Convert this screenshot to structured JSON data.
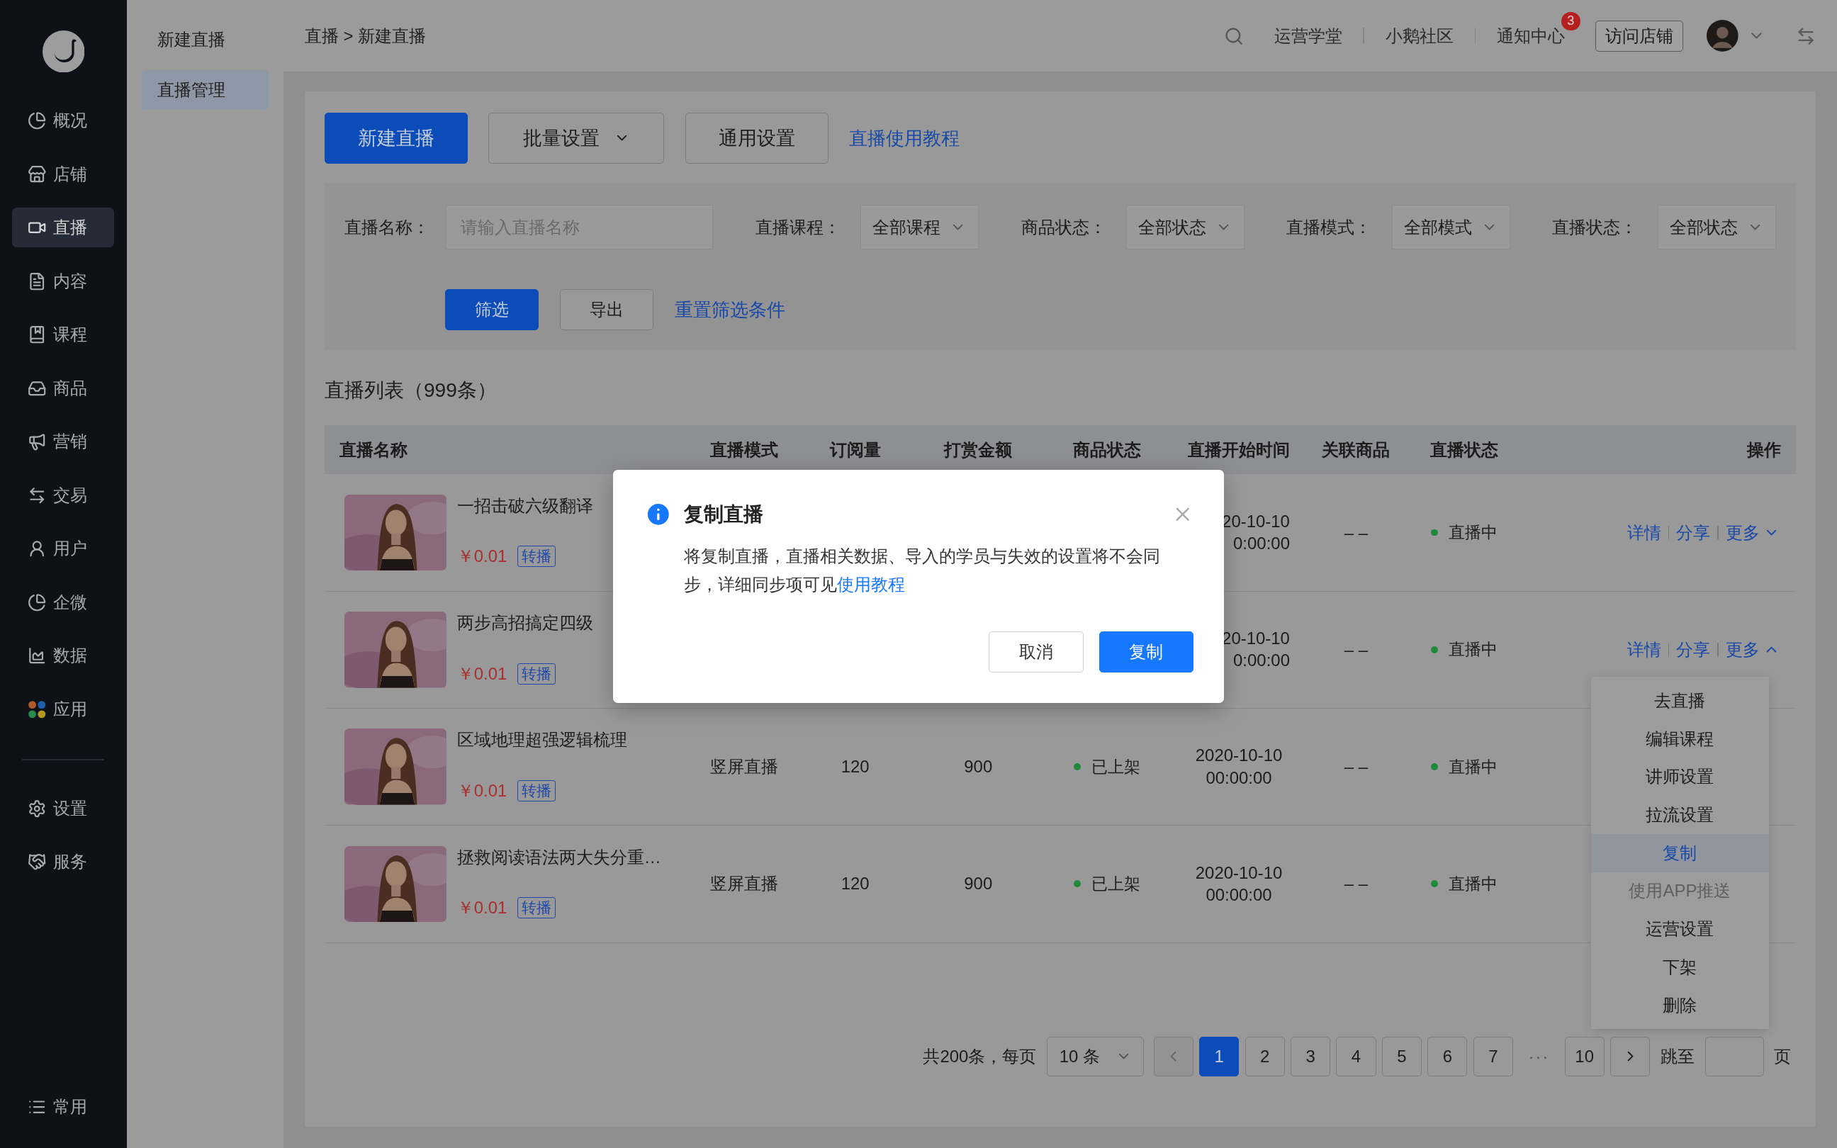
{
  "sidebar": {
    "items": [
      {
        "label": "概况",
        "selected": false
      },
      {
        "label": "店铺",
        "selected": false
      },
      {
        "label": "直播",
        "selected": true
      },
      {
        "label": "内容",
        "selected": false
      },
      {
        "label": "课程",
        "selected": false
      },
      {
        "label": "商品",
        "selected": false
      },
      {
        "label": "营销",
        "selected": false
      },
      {
        "label": "交易",
        "selected": false
      },
      {
        "label": "用户",
        "selected": false
      },
      {
        "label": "企微",
        "selected": false
      },
      {
        "label": "数据",
        "selected": false
      },
      {
        "label": "应用",
        "selected": false
      }
    ],
    "bottom_items": [
      {
        "label": "设置",
        "selected": false
      },
      {
        "label": "服务",
        "selected": false
      }
    ],
    "footer_item": {
      "label": "常用"
    }
  },
  "sub_sidebar": {
    "items": [
      {
        "label": "新建直播",
        "selected": false
      },
      {
        "label": "直播管理",
        "selected": true
      }
    ]
  },
  "breadcrumb": "直播 > 新建直播",
  "header": {
    "links": [
      "运营学堂",
      "小鹅社区",
      "通知中心"
    ],
    "notification_badge": "3",
    "store_button": "访问店铺"
  },
  "toolbar": {
    "buttons": [
      {
        "label": "新建直播",
        "kind": "primary"
      },
      {
        "label": "批量设置",
        "kind": "dropdown"
      },
      {
        "label": "通用设置",
        "kind": "default"
      }
    ],
    "tutorial_link": "直播使用教程"
  },
  "filters": {
    "name_field": {
      "label": "直播名称：",
      "placeholder": "请输入直播名称"
    },
    "selects": [
      {
        "label": "直播课程：",
        "value": "全部课程"
      },
      {
        "label": "商品状态：",
        "value": "全部状态"
      },
      {
        "label": "直播模式：",
        "value": "全部模式"
      },
      {
        "label": "直播状态：",
        "value": "全部状态"
      }
    ],
    "buttons": [
      {
        "label": "筛选",
        "kind": "primary"
      },
      {
        "label": "导出",
        "kind": "default"
      }
    ],
    "reset_link": "重置筛选条件"
  },
  "list_title": "直播列表（999条）",
  "table": {
    "columns": [
      "直播名称",
      "直播模式",
      "订阅量",
      "打赏金额",
      "商品状态",
      "直播开始时间",
      "关联商品",
      "直播状态",
      "操作"
    ],
    "rows": [
      {
        "kind": "covered",
        "name": "一招击破六级翻译",
        "price": "￥0.01",
        "tag": "转播",
        "start_time": [
          "20-10-10",
          "0:00:00"
        ],
        "related": "– –",
        "live_status": "直播中",
        "actions": [
          "详情",
          "分享"
        ],
        "more": {
          "label": "更多",
          "expanded": false
        }
      },
      {
        "kind": "covered",
        "name": "两步高招搞定四级",
        "price": "￥0.01",
        "tag": "转播",
        "start_time": [
          "20-10-10",
          "0:00:00"
        ],
        "related": "– –",
        "live_status": "直播中",
        "actions": [
          "详情",
          "分享"
        ],
        "more": {
          "label": "更多",
          "expanded": true
        }
      },
      {
        "kind": "full",
        "name": "区域地理超强逻辑梳理",
        "price": "￥0.01",
        "tag": "转播",
        "mode": "竖屏直播",
        "subscriptions": "120",
        "amount": "900",
        "product_status": "已上架",
        "start_time": [
          "2020-10-10",
          "00:00:00"
        ],
        "related": "– –",
        "live_status": "直播中"
      },
      {
        "kind": "full",
        "name": "拯救阅读语法两大失分重…",
        "price": "￥0.01",
        "tag": "转播",
        "mode": "竖屏直播",
        "subscriptions": "120",
        "amount": "900",
        "product_status": "已上架",
        "start_time": [
          "2020-10-10",
          "00:00:00"
        ],
        "related": "– –",
        "live_status": "直播中"
      }
    ]
  },
  "pagination": {
    "total": "共200条，每页",
    "page_size": "10 条",
    "pages": [
      {
        "label": "1",
        "selected": true
      },
      {
        "label": "2",
        "selected": false
      },
      {
        "label": "3",
        "selected": false
      },
      {
        "label": "4",
        "selected": false
      },
      {
        "label": "5",
        "selected": false
      },
      {
        "label": "6",
        "selected": false
      },
      {
        "label": "7",
        "selected": false
      }
    ],
    "ellipsis": "···",
    "last_page": "10",
    "jump_label": "跳至",
    "jump_suffix": "页"
  },
  "more_menu": {
    "items": [
      {
        "label": "去直播",
        "selected": false,
        "disabled": false
      },
      {
        "label": "编辑课程",
        "selected": false,
        "disabled": false
      },
      {
        "label": "讲师设置",
        "selected": false,
        "disabled": false
      },
      {
        "label": "拉流设置",
        "selected": false,
        "disabled": false
      },
      {
        "label": "复制",
        "selected": true,
        "disabled": false
      },
      {
        "label": "使用APP推送",
        "selected": false,
        "disabled": true
      },
      {
        "label": "运营设置",
        "selected": false,
        "disabled": false
      },
      {
        "label": "下架",
        "selected": false,
        "disabled": false
      },
      {
        "label": "删除",
        "selected": false,
        "disabled": false
      }
    ]
  },
  "dialog": {
    "title": "复制直播",
    "message": "将复制直播，直播相关数据、导入的学员与失效的设置将不会同步，详细同步项可见",
    "link": "使用教程",
    "buttons": [
      {
        "label": "取消",
        "kind": "default"
      },
      {
        "label": "复制",
        "kind": "primary"
      }
    ]
  }
}
